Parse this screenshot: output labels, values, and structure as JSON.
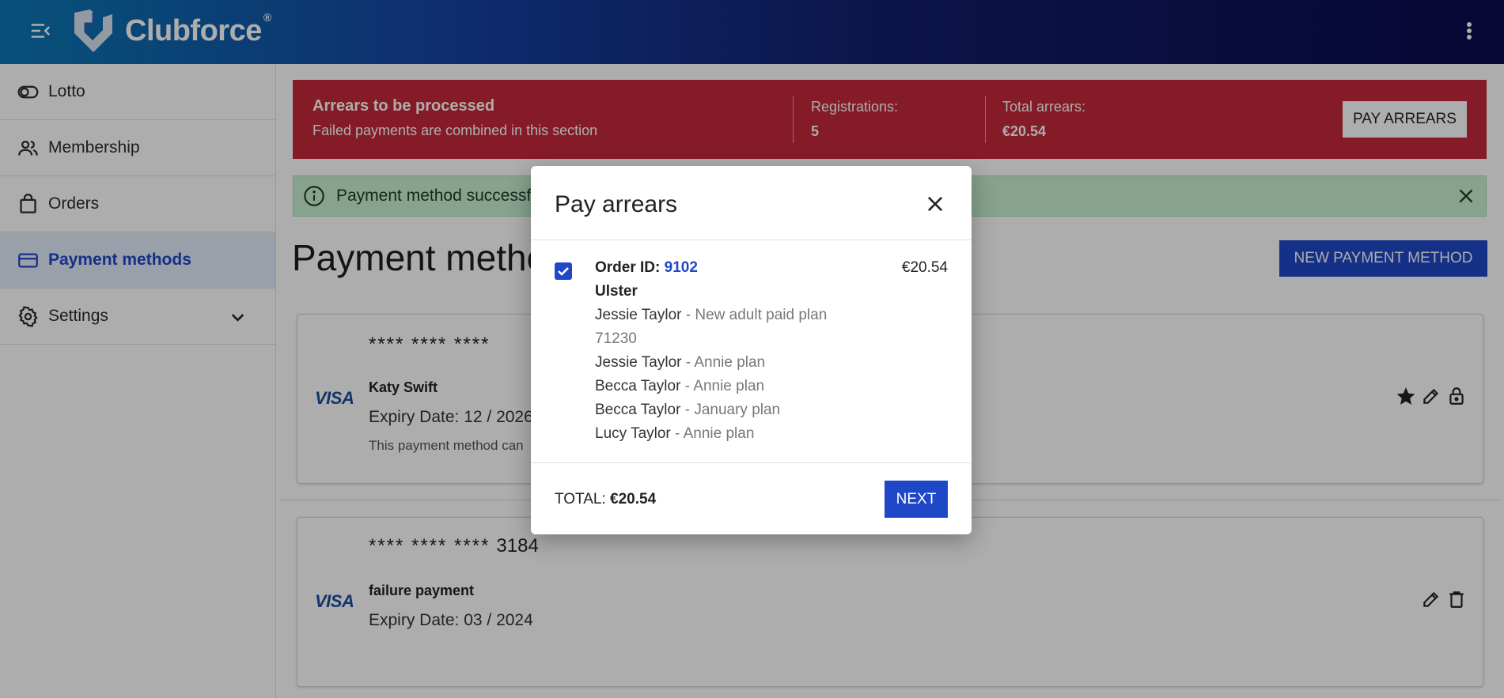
{
  "app": {
    "brand": "Clubforce",
    "brand_mark": "®"
  },
  "colors": {
    "accent": "#1f48c8",
    "danger": "#c4293a",
    "success_bg": "#c8efd1"
  },
  "sidebar": {
    "items": [
      {
        "label": "Lotto",
        "icon": "toggle-icon"
      },
      {
        "label": "Membership",
        "icon": "people-icon"
      },
      {
        "label": "Orders",
        "icon": "shopping-bag-icon"
      },
      {
        "label": "Payment methods",
        "icon": "credit-card-icon",
        "active": true
      },
      {
        "label": "Settings",
        "icon": "gear-icon",
        "expandable": true
      }
    ]
  },
  "arrears": {
    "title": "Arrears to be processed",
    "subtitle": "Failed payments are combined in this section",
    "registrations_label": "Registrations:",
    "registrations_value": "5",
    "total_label": "Total arrears:",
    "total_value": "€20.54",
    "button": "PAY ARREARS"
  },
  "success": {
    "text": "Payment method successfully"
  },
  "main": {
    "title": "Payment methods",
    "new_button": "NEW PAYMENT METHOD"
  },
  "cards": [
    {
      "masked": "**** **** ****",
      "last4": "",
      "brand": "VISA",
      "holder": "Katy Swift",
      "expiry": "Expiry Date: 12 / 2026",
      "note": "This payment method can"
    },
    {
      "masked": "**** **** ****",
      "last4": "3184",
      "brand": "VISA",
      "holder": "failure payment",
      "expiry": "Expiry Date: 03 / 2024"
    }
  ],
  "modal": {
    "title": "Pay arrears",
    "order_label": "Order ID:",
    "order_id": "9102",
    "amount": "€20.54",
    "club": "Ulster",
    "lines": [
      {
        "name": "Jessie Taylor",
        "sep": " - ",
        "plan": "New adult paid plan"
      },
      {
        "extra": "71230"
      },
      {
        "name": "Jessie Taylor",
        "sep": " - ",
        "plan": "Annie plan"
      },
      {
        "name": "Becca Taylor",
        "sep": " - ",
        "plan": "Annie plan"
      },
      {
        "name": "Becca Taylor",
        "sep": " - ",
        "plan": "January plan"
      },
      {
        "name": "Lucy Taylor",
        "sep": " - ",
        "plan": "Annie plan"
      }
    ],
    "total_label": "TOTAL:",
    "total_value": "€20.54",
    "next": "NEXT"
  }
}
